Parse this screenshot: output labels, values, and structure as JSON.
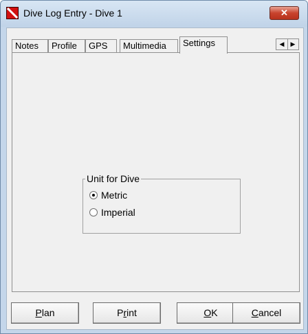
{
  "window": {
    "title": "Dive Log Entry - Dive 1",
    "close_label": "✕"
  },
  "tabs": [
    {
      "label": "Notes"
    },
    {
      "label": "Profile"
    },
    {
      "label": "GPS"
    },
    {
      "label": "Multimedia"
    },
    {
      "label": "Settings",
      "active": true
    }
  ],
  "tab_scroll": {
    "left": "◀",
    "right": "▶"
  },
  "settings": {
    "group_title": "Unit for Dive",
    "options": [
      {
        "label": "Metric",
        "checked": true
      },
      {
        "label": "Imperial",
        "checked": false
      }
    ]
  },
  "buttons": {
    "plan": {
      "pre": "",
      "accel": "P",
      "post": "lan"
    },
    "print": {
      "pre": "P",
      "accel": "r",
      "post": "int"
    },
    "ok": {
      "pre": "",
      "accel": "O",
      "post": "K"
    },
    "cancel": {
      "pre": "",
      "accel": "C",
      "post": "ancel"
    }
  }
}
